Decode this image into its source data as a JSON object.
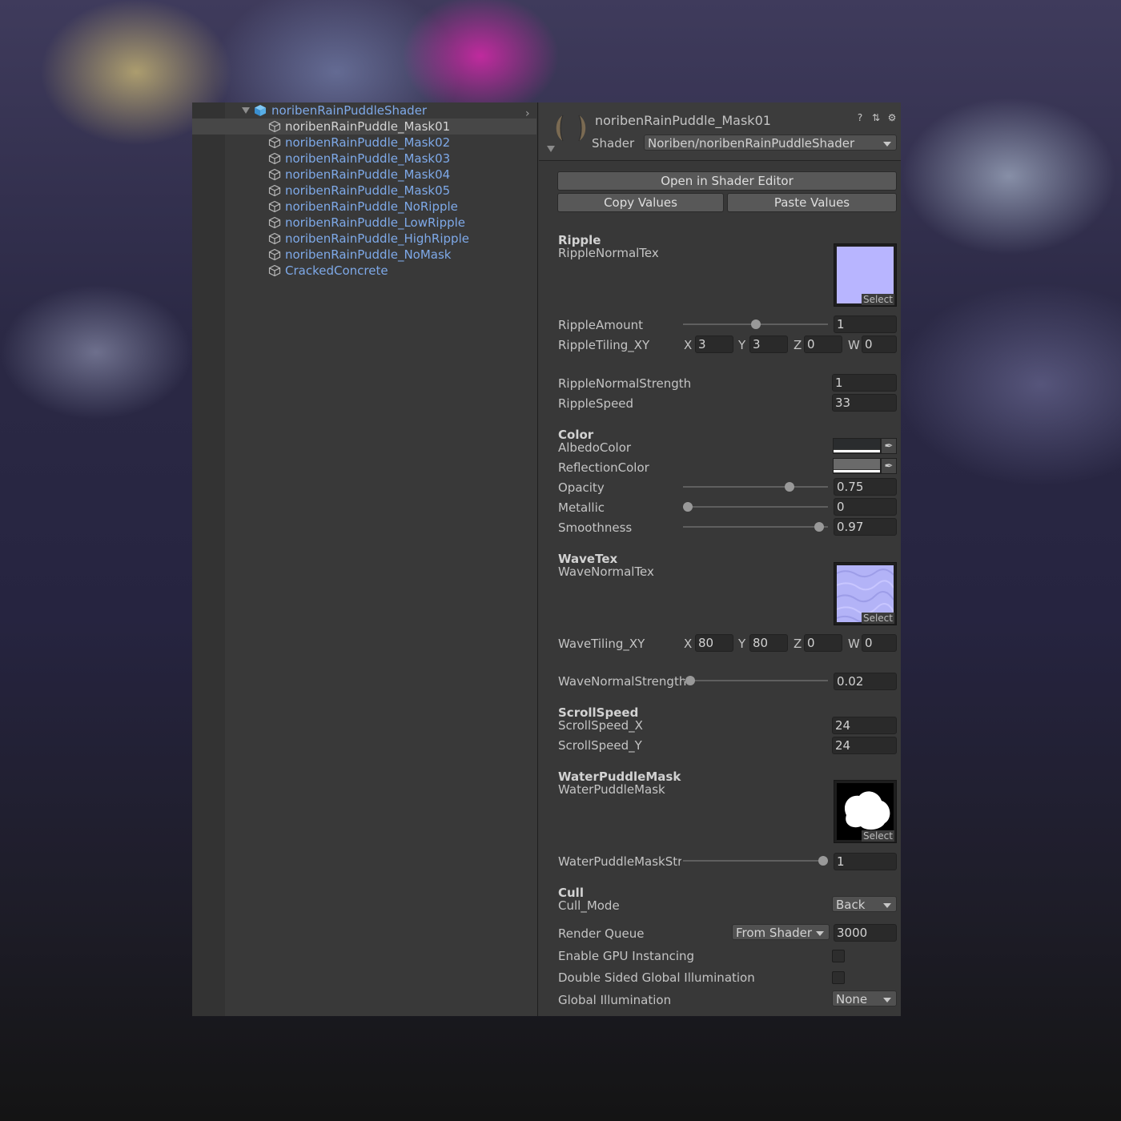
{
  "hierarchy": {
    "root": {
      "label": "noribenRainPuddleShader"
    },
    "items": [
      {
        "label": "noribenRainPuddle_Mask01"
      },
      {
        "label": "noribenRainPuddle_Mask02"
      },
      {
        "label": "noribenRainPuddle_Mask03"
      },
      {
        "label": "noribenRainPuddle_Mask04"
      },
      {
        "label": "noribenRainPuddle_Mask05"
      },
      {
        "label": "noribenRainPuddle_NoRipple"
      },
      {
        "label": "noribenRainPuddle_LowRipple"
      },
      {
        "label": "noribenRainPuddle_HighRipple"
      },
      {
        "label": "noribenRainPuddle_NoMask"
      },
      {
        "label": "CrackedConcrete"
      }
    ],
    "selected_index": 0
  },
  "inspector": {
    "title": "noribenRainPuddle_Mask01",
    "shader_label": "Shader",
    "shader_value": "Noriben/noribenRainPuddleShader",
    "header_icons": [
      "help-icon",
      "preset-icon",
      "gear-icon"
    ],
    "buttons": {
      "open_shader_editor": "Open in Shader Editor",
      "copy_values": "Copy Values",
      "paste_values": "Paste Values"
    },
    "texture_select_label": "Select",
    "ripple": {
      "section": "Ripple",
      "normal_tex_label": "RippleNormalTex",
      "amount_label": "RippleAmount",
      "amount_value": "1",
      "amount_slider_level": 0.5,
      "tiling_label": "RippleTiling_XY",
      "tiling": {
        "x": "3",
        "y": "3",
        "z": "0",
        "w": "0"
      },
      "normal_strength_label": "RippleNormalStrength",
      "normal_strength_value": "1",
      "speed_label": "RippleSpeed",
      "speed_value": "33"
    },
    "axes": {
      "x": "X",
      "y": "Y",
      "z": "Z",
      "w": "W"
    },
    "color": {
      "section": "Color",
      "albedo_label": "AlbedoColor",
      "albedo_color": "#2a2c2e",
      "reflection_label": "ReflectionColor",
      "reflection_color": "#6a6a6a",
      "opacity_label": "Opacity",
      "opacity_value": "0.75",
      "opacity_slider_level": 0.75,
      "metallic_label": "Metallic",
      "metallic_value": "0",
      "metallic_slider_level": 0,
      "smoothness_label": "Smoothness",
      "smoothness_value": "0.97",
      "smoothness_slider_level": 0.97
    },
    "wave": {
      "section": "WaveTex",
      "normal_tex_label": "WaveNormalTex",
      "tiling_label": "WaveTiling_XY",
      "tiling": {
        "x": "80",
        "y": "80",
        "z": "0",
        "w": "0"
      },
      "normal_strength_label": "WaveNormalStrength",
      "normal_strength_value": "0.02",
      "normal_strength_slider_level": 0.02
    },
    "scroll": {
      "section": "ScrollSpeed",
      "x_label": "ScrollSpeed_X",
      "x_value": "24",
      "y_label": "ScrollSpeed_Y",
      "y_value": "24"
    },
    "mask": {
      "section": "WaterPuddleMask",
      "tex_label": "WaterPuddleMask",
      "strength_label": "WaterPuddleMaskStr",
      "strength_value": "1",
      "strength_slider_level": 1
    },
    "cull": {
      "section": "Cull",
      "mode_label": "Cull_Mode",
      "mode_value": "Back"
    },
    "render_queue": {
      "label": "Render Queue",
      "mode": "From Shader",
      "value": "3000"
    },
    "gpu_instancing": {
      "label": "Enable GPU Instancing",
      "checked": false
    },
    "double_sided_gi": {
      "label": "Double Sided Global Illumination",
      "checked": false
    },
    "global_illumination": {
      "label": "Global Illumination",
      "value": "None"
    }
  },
  "colors": {
    "link_blue": "#7ea9e8",
    "panel_bg": "#383838",
    "ripple_tex": "#b8b5ff",
    "wave_tex": "#b3b3f7"
  }
}
